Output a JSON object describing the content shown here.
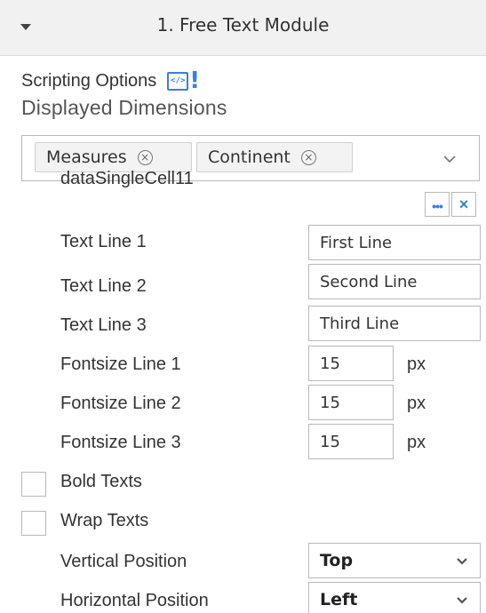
{
  "header": {
    "title": "1. Free Text Module",
    "toggle_icon": "caret-down-icon"
  },
  "scripting": {
    "label": "Scripting Options",
    "icon": "script-alert-icon",
    "icon_code": "</>",
    "icon_mark": "!",
    "accent": "#3b7fd4"
  },
  "dimensions": {
    "title": "Displayed Dimensions",
    "tokens": [
      {
        "label": "Measures"
      },
      {
        "label": "Continent"
      }
    ],
    "remove_glyph": "×"
  },
  "cell": {
    "label": "dataSingleCell11",
    "more_glyph": "•••",
    "clear_glyph": "×"
  },
  "text_lines": [
    {
      "label": "Text Line 1",
      "value": "First Line"
    },
    {
      "label": "Text Line 2",
      "value": "Second Line"
    },
    {
      "label": "Text Line 3",
      "value": "Third Line"
    }
  ],
  "font_sizes": [
    {
      "label": "Fontsize Line 1",
      "value": "15",
      "unit": "px"
    },
    {
      "label": "Fontsize Line 2",
      "value": "15",
      "unit": "px"
    },
    {
      "label": "Fontsize Line 3",
      "value": "15",
      "unit": "px"
    }
  ],
  "checkboxes": [
    {
      "label": "Bold Texts",
      "checked": false
    },
    {
      "label": "Wrap Texts",
      "checked": false
    }
  ],
  "positions": [
    {
      "label": "Vertical Position",
      "value": "Top"
    },
    {
      "label": "Horizontal Position",
      "value": "Left"
    }
  ]
}
